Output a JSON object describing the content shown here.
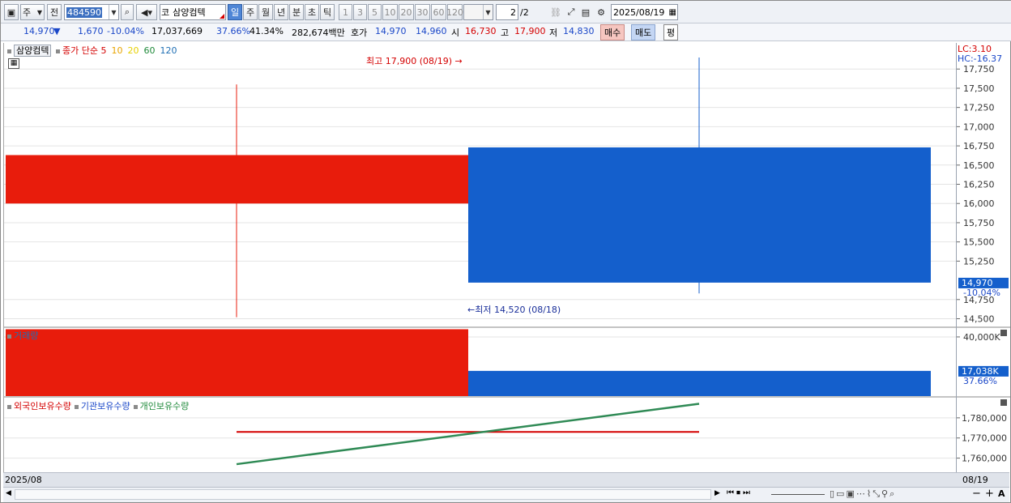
{
  "toolbar": {
    "period_label": "주",
    "prev_label": "전",
    "code": "484590",
    "market": "코",
    "stock_name": "삼양컴텍",
    "tabs": [
      "일",
      "주",
      "월",
      "년",
      "분",
      "초",
      "틱"
    ],
    "active_tab": "일",
    "intervals": [
      "1",
      "3",
      "5",
      "10",
      "20",
      "30",
      "60",
      "120"
    ],
    "page": "2",
    "page_total": "/2",
    "date": "2025/08/19"
  },
  "quote": {
    "price": "14,970",
    "change_arrow": "▼",
    "change": "1,670",
    "change_pct": "-10.04%",
    "volume": "17,037,669",
    "vol_ratio": "37.66%",
    "ratio2": "41.34%",
    "amount": "282,674백만",
    "hoga_label": "호가",
    "ask": "14,970",
    "bid": "14,960",
    "open_label": "시",
    "open": "16,730",
    "high_label": "고",
    "high": "17,900",
    "low_label": "저",
    "low": "14,830",
    "buy_label": "매수",
    "sell_label": "매도",
    "pyeong_label": "평"
  },
  "price_pane": {
    "title": "삼양컴텍",
    "ma_legend": [
      {
        "label": "종가 단순 5",
        "color": "#d40000"
      },
      {
        "label": "10",
        "color": "#e8a400"
      },
      {
        "label": "20",
        "color": "#e6d000"
      },
      {
        "label": "60",
        "color": "#1f8a3a"
      },
      {
        "label": "120",
        "color": "#1f6fb4"
      }
    ],
    "lc": "LC:3.10",
    "hc": "HC:-16.37",
    "high_note": "최고 17,900 (08/19)",
    "low_note": "최저 14,520 (08/18)",
    "current_tag": "14,970",
    "current_pct": "-10.04%",
    "y_ticks": [
      "17,750",
      "17,500",
      "17,250",
      "17,000",
      "16,750",
      "16,500",
      "16,250",
      "16,000",
      "15,750",
      "15,500",
      "15,250",
      "14,750",
      "14,500"
    ]
  },
  "volume_pane": {
    "title": "거래량",
    "tick": "40,000K",
    "current_tag": "17,038K",
    "current_pct": "37.66%"
  },
  "holding_pane": {
    "legend": [
      {
        "label": "외국인보유수량",
        "color": "#d40000"
      },
      {
        "label": "기관보유수량",
        "color": "#1a47c8"
      },
      {
        "label": "개인보유수량",
        "color": "#1f8a3a"
      }
    ],
    "y_ticks": [
      "1,780,000",
      "1,770,000",
      "1,760,000"
    ]
  },
  "x_axis": {
    "left_label": "2025/08",
    "right_label": "08/19"
  },
  "chart_data": {
    "type": "candlestick",
    "candles": [
      {
        "date": "08/18",
        "open": 16630,
        "high": 17550,
        "low": 14520,
        "close": 16000,
        "color": "#e81c0c"
      },
      {
        "date": "08/19",
        "open": 16730,
        "high": 17900,
        "low": 14830,
        "close": 14970,
        "color": "#145fcc"
      }
    ],
    "price_range": [
      14400,
      17900
    ],
    "volume": [
      {
        "date": "08/18",
        "value": 45200
      },
      {
        "date": "08/19",
        "value": 17038
      }
    ],
    "volume_range": [
      0,
      46000
    ],
    "holdings": {
      "foreign": [
        1773000,
        1773000
      ],
      "individual": [
        1757000,
        1787000
      ],
      "range": [
        1753000,
        1790000
      ]
    },
    "colors": {
      "up": "#e81c0c",
      "down": "#145fcc"
    }
  }
}
